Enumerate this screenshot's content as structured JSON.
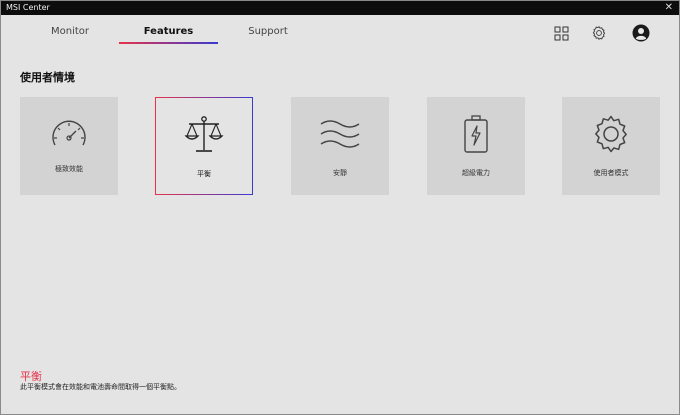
{
  "window": {
    "title": "MSI Center",
    "close_label": "✕"
  },
  "tabs": [
    {
      "label": "Monitor"
    },
    {
      "label": "Features"
    },
    {
      "label": "Support"
    }
  ],
  "section_title": "使用者情境",
  "cards": [
    {
      "label": "極致效能",
      "icon": "speedometer-icon"
    },
    {
      "label": "平衡",
      "icon": "balance-scale-icon"
    },
    {
      "label": "安靜",
      "icon": "waves-icon"
    },
    {
      "label": "超級電力",
      "icon": "battery-bolt-icon"
    },
    {
      "label": "使用者模式",
      "icon": "gear-icon"
    }
  ],
  "selected_card": "平衡",
  "footer": {
    "title": "平衡",
    "description": "此平衡模式會在效能和電池壽命間取得一個平衡點。"
  },
  "colors": {
    "accent_red": "#e6334a",
    "accent_blue": "#3a3ad0",
    "background": "#e4e4e4",
    "card": "#d3d3d3"
  }
}
